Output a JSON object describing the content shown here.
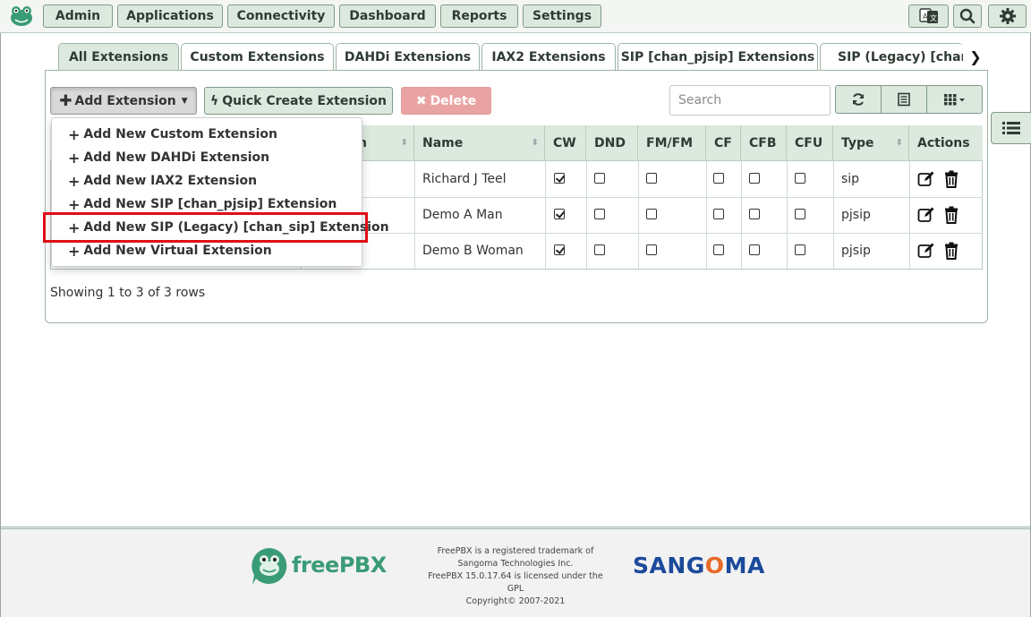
{
  "nav": {
    "items": [
      "Admin",
      "Applications",
      "Connectivity",
      "Dashboard",
      "Reports",
      "Settings"
    ]
  },
  "tabs": [
    "All Extensions",
    "Custom Extensions",
    "DAHDi Extensions",
    "IAX2 Extensions",
    "SIP [chan_pjsip] Extensions",
    "SIP (Legacy) [chan_sip] Extensions"
  ],
  "toolbar": {
    "add_label": "Add Extension",
    "quick_label": "Quick Create Extension",
    "delete_label": "Delete",
    "search_placeholder": "Search"
  },
  "dropdown": {
    "items": [
      "Add New Custom Extension",
      "Add New DAHDi Extension",
      "Add New IAX2 Extension",
      "Add New SIP [chan_pjsip] Extension",
      "Add New SIP (Legacy) [chan_sip] Extension",
      "Add New Virtual Extension"
    ]
  },
  "table": {
    "partial_header": "n",
    "columns": [
      "Name",
      "CW",
      "DND",
      "FM/FM",
      "CF",
      "CFB",
      "CFU",
      "Type",
      "Actions"
    ],
    "rows": [
      {
        "name": "Richard J Teel",
        "cw": true,
        "dnd": false,
        "fmfm": false,
        "cf": false,
        "cfb": false,
        "cfu": false,
        "type": "sip"
      },
      {
        "name": "Demo A Man",
        "cw": true,
        "dnd": false,
        "fmfm": false,
        "cf": false,
        "cfb": false,
        "cfu": false,
        "type": "pjsip"
      },
      {
        "name": "Demo B Woman",
        "cw": true,
        "dnd": false,
        "fmfm": false,
        "cf": false,
        "cfb": false,
        "cfu": false,
        "type": "pjsip"
      }
    ]
  },
  "rows_info": "Showing 1 to 3 of 3 rows",
  "footer": {
    "freepbx_word": "freePBX",
    "sangoma_left": "SANG",
    "sangoma_o": "O",
    "sangoma_right": "MA",
    "lines": [
      "FreePBX is a registered trademark of",
      "Sangoma Technologies Inc.",
      "FreePBX 15.0.17.64 is licensed under the",
      "GPL",
      "Copyright© 2007-2021"
    ]
  },
  "colors": {
    "accent": "#dde9df",
    "border": "#7f9a88",
    "danger": "#eaa3a3",
    "highlight": "#e00d16"
  }
}
